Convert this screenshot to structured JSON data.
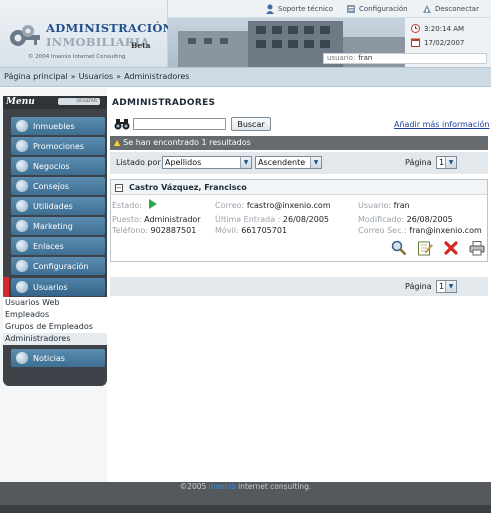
{
  "logo": {
    "line1": "ADMINISTRACIÓN",
    "line2": "INMOBILIARIA",
    "beta": "Beta",
    "copyright": "© 2004 Inxenio Internet Consulting"
  },
  "toplinks": {
    "support": "Soporte técnico",
    "settings": "Configuración",
    "logout": "Desconectar"
  },
  "session": {
    "time": "3:20:14 AM",
    "date": "17/02/2007",
    "user_label": "usuario:",
    "user": "fran"
  },
  "breadcrumb": {
    "items": [
      "Página principal",
      "Usuarios",
      "Administradores"
    ],
    "separator": "»"
  },
  "sidebar": {
    "title": "Menu",
    "collapse_label": "OCULTAR",
    "items": [
      {
        "label": "Inmuebles",
        "icon": "house-icon"
      },
      {
        "label": "Promociones",
        "icon": "promotion-icon"
      },
      {
        "label": "Negocios",
        "icon": "business-icon"
      },
      {
        "label": "Consejos",
        "icon": "tips-icon"
      },
      {
        "label": "Utilidades",
        "icon": "gear-icon"
      },
      {
        "label": "Marketing",
        "icon": "marketing-icon"
      },
      {
        "label": "Enlaces",
        "icon": "links-icon"
      },
      {
        "label": "Configuración",
        "icon": "gear-icon"
      },
      {
        "label": "Usuarios",
        "icon": "users-icon",
        "active": true
      },
      {
        "label": "Noticias",
        "icon": "news-icon"
      }
    ],
    "submenu": [
      "Usuarios Web",
      "Empleados",
      "Grupos de Empleados",
      "Administradores"
    ],
    "active_color": "#d22b2b"
  },
  "main": {
    "title": "ADMINISTRADORES",
    "search": {
      "value": "",
      "button": "Buscar"
    },
    "add_more": "Añadir más información",
    "results_icon": "warning-icon",
    "results_text": "Se han encontrado 1 resultados",
    "sort": {
      "label": "Listado por",
      "field": "Apellidos",
      "order": "Ascendente",
      "page_label": "Página",
      "page": "1"
    },
    "record": {
      "name": "Castro Vázquez, Francisco",
      "estado_label": "Estado:",
      "correo_label": "Correo:",
      "correo": "fcastro@inxenio.com",
      "usuario_label": "Usuario:",
      "usuario": "fran",
      "puesto_label": "Puesto:",
      "puesto": "Administrador",
      "ultima_label": "Última Entrada :",
      "ultima": "26/08/2005",
      "modificado_label": "Modificado:",
      "modificado": "26/08/2005",
      "telefono_label": "Teléfono:",
      "telefono": "902887501",
      "movil_label": "Móvil:",
      "movil": "661705701",
      "correo_sec_label": "Correo Sec.:",
      "correo_sec": "fran@inxenio.com",
      "actions": [
        "search-icon",
        "edit-icon",
        "delete-icon",
        "print-icon"
      ]
    },
    "bottom_page_label": "Página",
    "bottom_page": "1"
  },
  "footer": {
    "prefix": "©2005 ",
    "brand": "inxenio",
    "suffix": " internet consulting."
  }
}
